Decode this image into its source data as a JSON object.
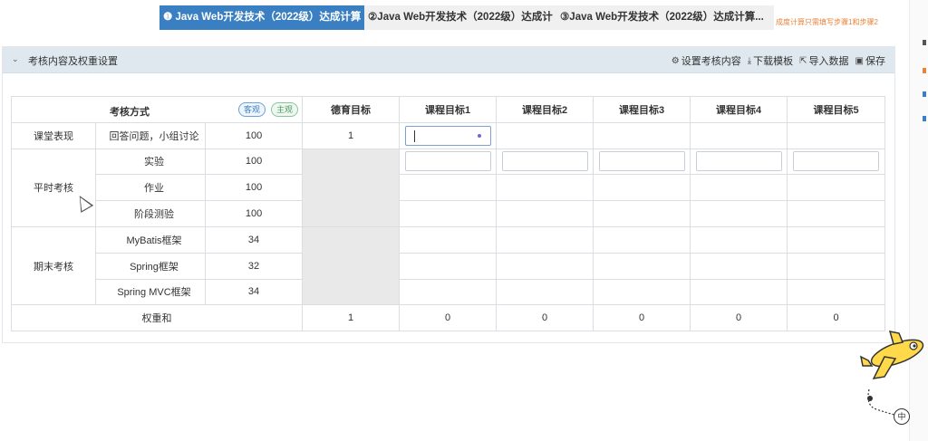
{
  "steps": {
    "items": [
      {
        "label": "❶ Java Web开发技术（2022级）达成计算"
      },
      {
        "label": "②Java Web开发技术（2022级）达成计"
      },
      {
        "label": "③Java Web开发技术（2022级）达成计算..."
      }
    ],
    "hint": "成度计算只需填写步骤1和步骤2"
  },
  "panel": {
    "title": "考核内容及权重设置",
    "actions": {
      "set_content": "设置考核内容",
      "download_template": "下载模板",
      "import_data": "导入数据",
      "save": "保存"
    }
  },
  "table": {
    "method_header": "考核方式",
    "tag_objective": "客观",
    "tag_subjective": "主观",
    "target_headers": [
      "德育目标",
      "课程目标1",
      "课程目标2",
      "课程目标3",
      "课程目标4",
      "课程目标5"
    ],
    "categories": [
      "课堂表现",
      "平时考核",
      "期末考核"
    ],
    "rows": [
      {
        "item": "回答问题，小组讨论",
        "weight": "100",
        "moral": "1"
      },
      {
        "item": "实验",
        "weight": "100"
      },
      {
        "item": "作业",
        "weight": "100"
      },
      {
        "item": "阶段测验",
        "weight": "100"
      },
      {
        "item": "MyBatis框架",
        "weight": "34"
      },
      {
        "item": "Spring框架",
        "weight": "32"
      },
      {
        "item": "Spring MVC框架",
        "weight": "34"
      }
    ],
    "sum_label": "权重和",
    "sums": [
      "1",
      "0",
      "0",
      "0",
      "0",
      "0"
    ]
  },
  "widget": {
    "lang_label": "中"
  },
  "colors": {
    "accent": "#3a7fc1",
    "category_link": "#3b82c4",
    "sum_orange": "#d9603b",
    "hint_orange": "#e8833a"
  }
}
